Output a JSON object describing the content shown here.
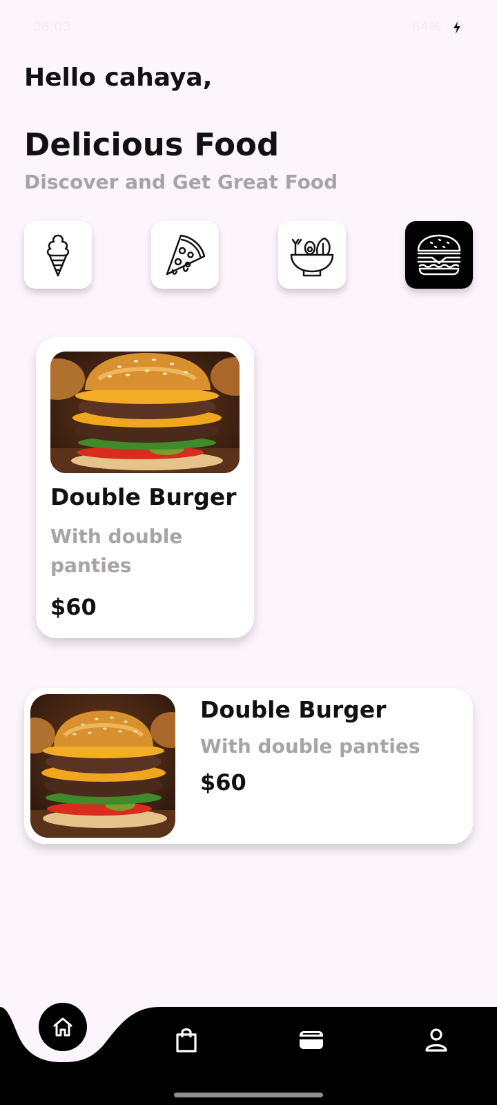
{
  "status_bar": {
    "left_text": "08:03",
    "right_text": "84%"
  },
  "header": {
    "greeting": "Hello cahaya,",
    "title": "Delicious Food",
    "subtitle": "Discover and Get Great Food"
  },
  "categories": [
    {
      "icon": "ice-cream-icon",
      "active": false
    },
    {
      "icon": "pizza-icon",
      "active": false
    },
    {
      "icon": "salad-bowl-icon",
      "active": false
    },
    {
      "icon": "burger-icon",
      "active": true
    }
  ],
  "cards": [
    {
      "name": "Double Burger",
      "description": "With double panties",
      "price": "$60"
    },
    {
      "name": "Double Burger",
      "description": "With double panties",
      "price": "$60"
    }
  ],
  "bottom_nav": {
    "items": [
      {
        "icon": "home-icon",
        "active": true
      },
      {
        "icon": "shopping-bag-icon",
        "active": false
      },
      {
        "icon": "wallet-icon",
        "active": false
      },
      {
        "icon": "profile-icon",
        "active": false
      }
    ]
  },
  "colors": {
    "background": "#fcf5fb",
    "text_primary": "#111111",
    "text_secondary": "#a7a3a7",
    "nav_background": "#000000"
  }
}
